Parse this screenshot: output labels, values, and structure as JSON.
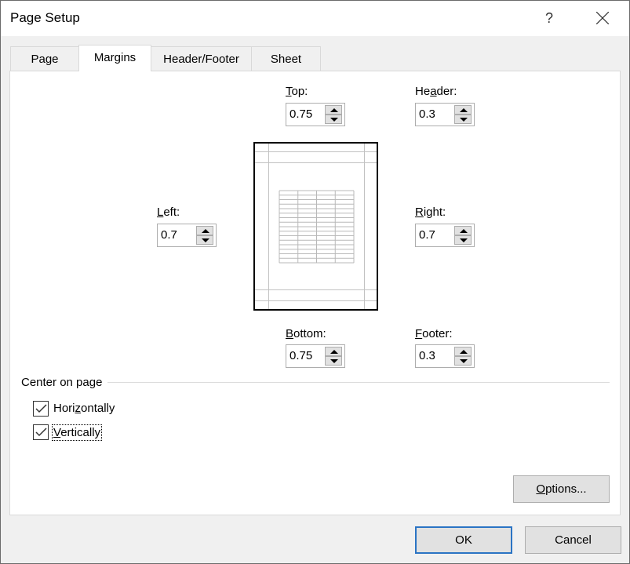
{
  "window": {
    "title": "Page Setup",
    "help_label": "?",
    "close_icon": "close-icon"
  },
  "tabs": [
    {
      "label": "Page",
      "active": false
    },
    {
      "label": "Margins",
      "active": true
    },
    {
      "label": "Header/Footer",
      "active": false
    },
    {
      "label": "Sheet",
      "active": false
    }
  ],
  "margins": {
    "top": {
      "label_u": "T",
      "label_rest": "op:",
      "value": "0.75"
    },
    "header": {
      "label_pre": "He",
      "label_u": "a",
      "label_rest": "der:",
      "value": "0.3"
    },
    "left": {
      "label_u": "L",
      "label_rest": "eft:",
      "value": "0.7"
    },
    "right": {
      "label_u": "R",
      "label_rest": "ight:",
      "value": "0.7"
    },
    "bottom": {
      "label_u": "B",
      "label_rest": "ottom:",
      "value": "0.75"
    },
    "footer": {
      "label_u": "F",
      "label_rest": "ooter:",
      "value": "0.3"
    }
  },
  "center_on_page": {
    "group_label": "Center on page",
    "horizontally": {
      "label_pre": "Hori",
      "label_u": "z",
      "label_rest": "ontally",
      "checked": true
    },
    "vertically": {
      "label_pre": "",
      "label_u": "V",
      "label_rest": "ertically",
      "checked": true
    }
  },
  "buttons": {
    "options": {
      "label_u": "O",
      "label_rest": "ptions..."
    },
    "ok": "OK",
    "cancel": "Cancel"
  }
}
